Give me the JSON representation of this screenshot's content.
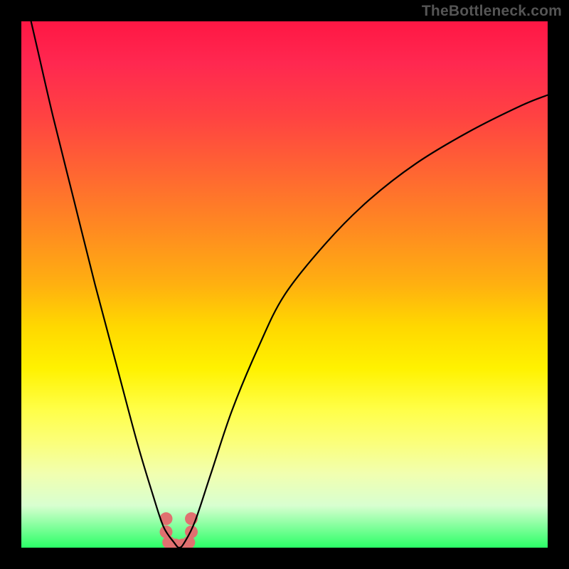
{
  "watermark": "TheBottleneck.com",
  "colors": {
    "background": "#000000",
    "gradient_top": "#ff1744",
    "gradient_bottom": "#2bff67",
    "curve": "#000000",
    "marker": "#e07070"
  },
  "chart_data": {
    "type": "line",
    "title": "",
    "xlabel": "",
    "ylabel": "",
    "xlim": [
      0,
      100
    ],
    "ylim": [
      0,
      100
    ],
    "description": "V-shaped bottleneck curve on red-to-green vertical gradient; minimum near x≈30 at y≈0 with small pink marker cluster at the trough.",
    "series": [
      {
        "name": "bottleneck-curve",
        "x": [
          0,
          3,
          6,
          10,
          14,
          18,
          22,
          25,
          27,
          29,
          30,
          31,
          33,
          36,
          40,
          45,
          50,
          58,
          66,
          75,
          85,
          95,
          100
        ],
        "values": [
          108,
          95,
          82,
          66,
          50,
          35,
          20,
          10,
          4,
          1,
          0,
          1,
          5,
          14,
          26,
          38,
          48,
          58,
          66,
          73,
          79,
          84,
          86
        ]
      }
    ],
    "markers": {
      "name": "trough-markers",
      "x": [
        27.5,
        27.5,
        28.0,
        29.3,
        30.6,
        31.8,
        32.3,
        32.3
      ],
      "y": [
        5.5,
        3.0,
        1.0,
        0.5,
        0.5,
        1.0,
        3.0,
        5.5
      ]
    }
  }
}
